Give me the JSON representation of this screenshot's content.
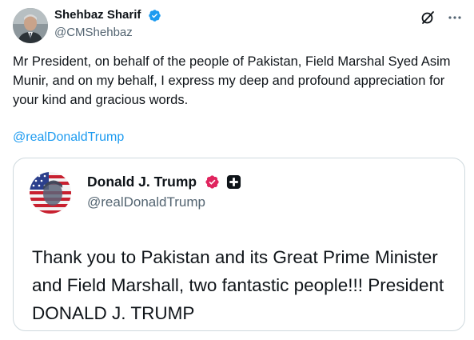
{
  "post": {
    "author": {
      "name": "Shehbaz Sharif",
      "handle": "@CMShehbaz",
      "verified": true
    },
    "text": "Mr President, on behalf of the people of Pakistan, Field Marshal Syed Asim Munir, and on my behalf, I express my deep and profound appreciation for your kind and gracious words.",
    "mention": "@realDonaldTrump",
    "icons": {
      "grok": "grok-icon",
      "more": "more-icon"
    }
  },
  "quote": {
    "author": {
      "name": "Donald J. Trump",
      "handle": "@realDonaldTrump",
      "badges": [
        "government-verified-icon",
        "affiliate-icon"
      ]
    },
    "text": "Thank you to Pakistan and its Great Prime Minister and Field Marshall, two fantastic people!!! President DONALD J. TRUMP"
  },
  "colors": {
    "link": "#1d9bf0",
    "secondary_text": "#536471",
    "verified_blue": "#1d9bf0",
    "government_badge": "#e0245e",
    "border": "#cfd9de"
  }
}
